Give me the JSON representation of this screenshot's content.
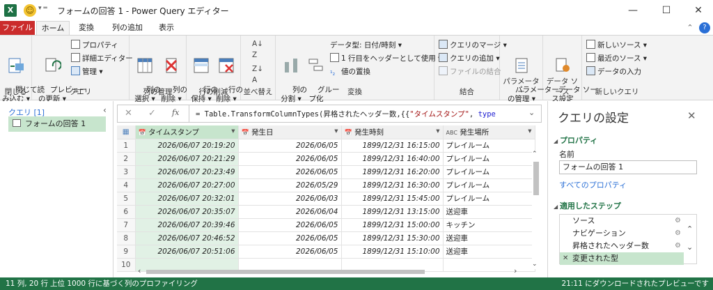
{
  "window": {
    "title": "フォームの回答 1 - Power Query エディター",
    "app_icon": "X",
    "minimize": "—",
    "maximize": "☐",
    "close": "✕"
  },
  "tabs": [
    {
      "label": "ファイル"
    },
    {
      "label": "ホーム"
    },
    {
      "label": "変換"
    },
    {
      "label": "列の追加"
    },
    {
      "label": "表示"
    }
  ],
  "ribbon": {
    "close_group": {
      "name": "閉じる",
      "btn": "閉じて読\nみ込む ▾"
    },
    "query_group": {
      "name": "クエリ",
      "preview": "プレビュー\nの更新 ▾",
      "properties": "プロパティ",
      "advanced": "詳細エディター",
      "manage": "管理 ▾"
    },
    "cols_group": {
      "name": "列の管理",
      "select": "列の\n選択 ▾",
      "remove": "列の\n削除 ▾"
    },
    "rows_group": {
      "name": "行の削減",
      "keep": "行の\n保持 ▾",
      "remove": "行の\n削除 ▾"
    },
    "sort_group": {
      "name": "並べ替え"
    },
    "transform_group": {
      "name": "変換",
      "split": "列の\n分割 ▾",
      "groupby": "グルー\nプ化",
      "datatype": "データ型: 日付/時刻 ▾",
      "header": "1 行目をヘッダーとして使用 ▾",
      "replace": "値の置換"
    },
    "combine_group": {
      "name": "結合",
      "merge": "クエリのマージ ▾",
      "append": "クエリの追加 ▾",
      "combine": "ファイルの結合"
    },
    "param_group": {
      "name": "パラメーター",
      "manage": "パラメーター\nの管理 ▾"
    },
    "datasource_group": {
      "name": "データ ソース",
      "settings": "データ ソー\nス設定"
    },
    "newquery_group": {
      "name": "新しいクエリ",
      "newsource": "新しいソース ▾",
      "recent": "最近のソース ▾",
      "enter": "データの入力"
    }
  },
  "left_panel": {
    "title": "クエリ [1]",
    "query_item": "フォームの回答 1"
  },
  "formula_bar": {
    "fx": "fx",
    "text_prefix": "= Table.TransformColumnTypes(昇格されたヘッダー数,{{",
    "text_str": "\"タイムスタンプ\"",
    "text_mid": ", ",
    "text_kw": "type"
  },
  "grid": {
    "columns": [
      {
        "type_icon": "📅",
        "name": "タイムスタンプ"
      },
      {
        "type_icon": "📅",
        "name": "発生日"
      },
      {
        "type_icon": "📅",
        "name": "発生時刻"
      },
      {
        "type_icon": "ABC",
        "name": "発生場所"
      }
    ],
    "rows": [
      [
        "1",
        "2026/06/07 20:19:20",
        "2026/06/05",
        "1899/12/31 16:15:00",
        "プレイルーム"
      ],
      [
        "2",
        "2026/06/07 20:21:29",
        "2026/06/05",
        "1899/12/31 16:40:00",
        "プレイルーム"
      ],
      [
        "3",
        "2026/06/07 20:23:49",
        "2026/06/05",
        "1899/12/31 16:20:00",
        "プレイルーム"
      ],
      [
        "4",
        "2026/06/07 20:27:00",
        "2026/05/29",
        "1899/12/31 16:30:00",
        "プレイルーム"
      ],
      [
        "5",
        "2026/06/07 20:32:01",
        "2026/06/03",
        "1899/12/31 15:45:00",
        "プレイルーム"
      ],
      [
        "6",
        "2026/06/07 20:35:07",
        "2026/06/04",
        "1899/12/31 13:15:00",
        "送迎車"
      ],
      [
        "7",
        "2026/06/07 20:39:46",
        "2026/06/05",
        "1899/12/31 15:00:00",
        "キッチン"
      ],
      [
        "8",
        "2026/06/07 20:46:52",
        "2026/06/05",
        "1899/12/31 15:30:00",
        "送迎車"
      ],
      [
        "9",
        "2026/06/07 20:51:06",
        "2026/06/05",
        "1899/12/31 15:10:00",
        "送迎車"
      ],
      [
        "10",
        "",
        "",
        "",
        ""
      ]
    ]
  },
  "right_panel": {
    "title": "クエリの設定",
    "properties_header": "プロパティ",
    "name_label": "名前",
    "name_value": "フォームの回答 1",
    "all_props_link": "すべてのプロパティ",
    "steps_header": "適用したステップ",
    "steps": [
      {
        "label": "ソース",
        "gear": true
      },
      {
        "label": "ナビゲーション",
        "gear": true
      },
      {
        "label": "昇格されたヘッダー数",
        "gear": true
      },
      {
        "label": "変更された型",
        "gear": false,
        "selected": true
      }
    ]
  },
  "status": {
    "left": "11 列, 20 行",
    "profiling": "上位 1000 行に基づく列のプロファイリング",
    "right": "21:11 にダウンロードされたプレビューです"
  },
  "colors": {
    "file_tab": "#cb2c2c",
    "status_bar": "#217346",
    "accent_teal": "#33b59e",
    "selected_green": "#d4ecdb"
  }
}
